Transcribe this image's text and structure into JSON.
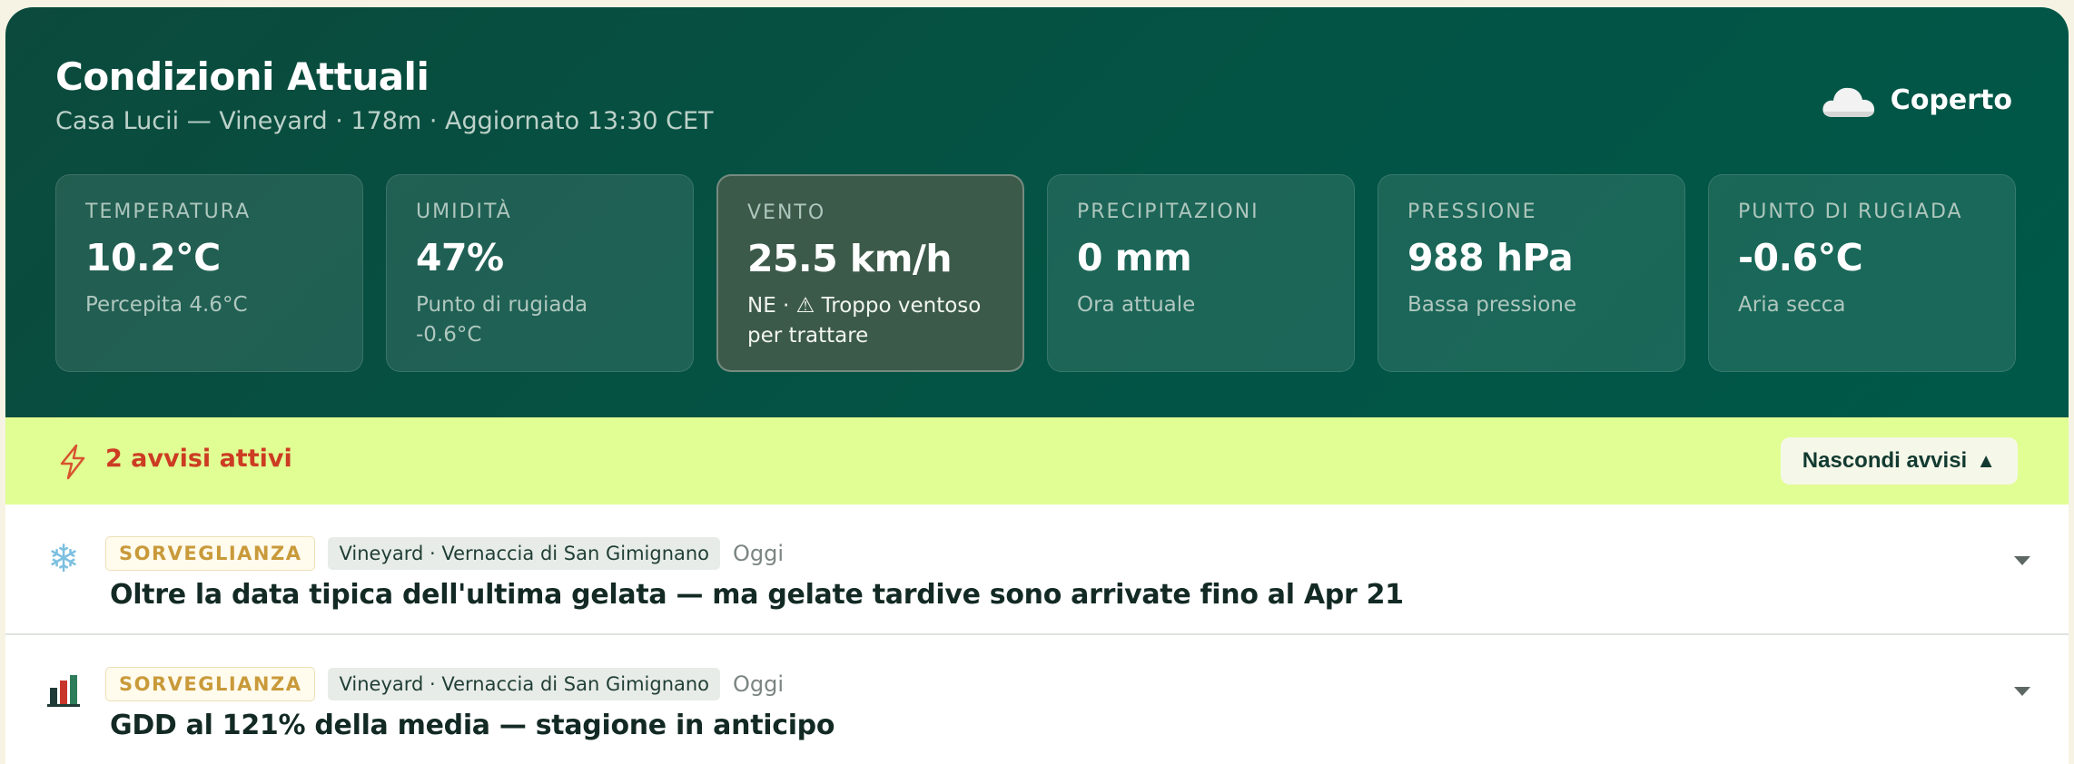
{
  "header": {
    "title": "Condizioni Attuali",
    "subtitle": "Casa Lucii — Vineyard · 178m · Aggiornato 13:30 CET",
    "condition": {
      "icon": "cloud-icon",
      "label": "Coperto"
    }
  },
  "metrics": [
    {
      "label": "TEMPERATURA",
      "value": "10.2°C",
      "sub": "Percepita 4.6°C"
    },
    {
      "label": "UMIDITÀ",
      "value": "47%",
      "sub": "Punto di rugiada -0.6°C"
    },
    {
      "label": "VENTO",
      "value": "25.5 km/h",
      "sub": "NE · ⚠ Troppo ventoso per trattare",
      "warning": true
    },
    {
      "label": "PRECIPITAZIONI",
      "value": "0 mm",
      "sub": "Ora attuale"
    },
    {
      "label": "PRESSIONE",
      "value": "988 hPa",
      "sub": "Bassa pressione"
    },
    {
      "label": "PUNTO DI RUGIADA",
      "value": "-0.6°C",
      "sub": "Aria secca"
    }
  ],
  "alerts_bar": {
    "icon": "lightning-icon",
    "count_label": "2 avvisi attivi",
    "hide_label": "Nascondi avvisi",
    "hide_arrow": "▲"
  },
  "alerts": [
    {
      "icon": "snowflake-icon",
      "severity": "SORVEGLIANZA",
      "location": "Vineyard · Vernaccia di San Gimignano",
      "date": "Oggi",
      "title": "Oltre la data tipica dell'ultima gelata — ma gelate tardive sono arrivate fino al Apr 21"
    },
    {
      "icon": "bar-chart-icon",
      "severity": "SORVEGLIANZA",
      "location": "Vineyard · Vernaccia di San Gimignano",
      "date": "Oggi",
      "title": "GDD al 121% della media — stagione in anticipo"
    }
  ],
  "colors": {
    "hero": "#035445",
    "alert_bar": "#e1fe94",
    "alert_text": "#cc3b22",
    "severity": "#c99a3a"
  }
}
